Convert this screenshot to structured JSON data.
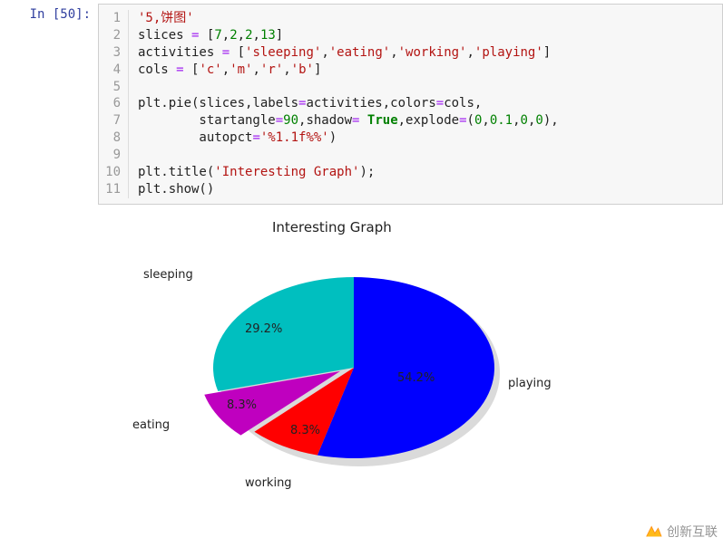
{
  "prompt": "In [50]:",
  "code": {
    "lines": [
      "'5,饼图'",
      "slices = [7,2,2,13]",
      "activities = ['sleeping','eating','working','playing']",
      "cols = ['c','m','r','b']",
      "",
      "plt.pie(slices,labels=activities,colors=cols,",
      "        startangle=90,shadow= True,explode=(0,0.1,0,0),",
      "        autopct='%1.1f%%')",
      "",
      "plt.title('Interesting Graph');",
      "plt.show()"
    ]
  },
  "chart_data": {
    "type": "pie",
    "title": "Interesting Graph",
    "series": [
      {
        "name": "sleeping",
        "value": 7,
        "pct": "29.2%",
        "color": "#00bfbf",
        "explode": 0
      },
      {
        "name": "eating",
        "value": 2,
        "pct": "8.3%",
        "color": "#bf00bf",
        "explode": 0.1
      },
      {
        "name": "working",
        "value": 2,
        "pct": "8.3%",
        "color": "#ff0000",
        "explode": 0
      },
      {
        "name": "playing",
        "value": 13,
        "pct": "54.2%",
        "color": "#0000ff",
        "explode": 0
      }
    ],
    "startangle": 90,
    "shadow": true,
    "autopct": "%1.1f%%"
  },
  "watermark": "创新互联"
}
